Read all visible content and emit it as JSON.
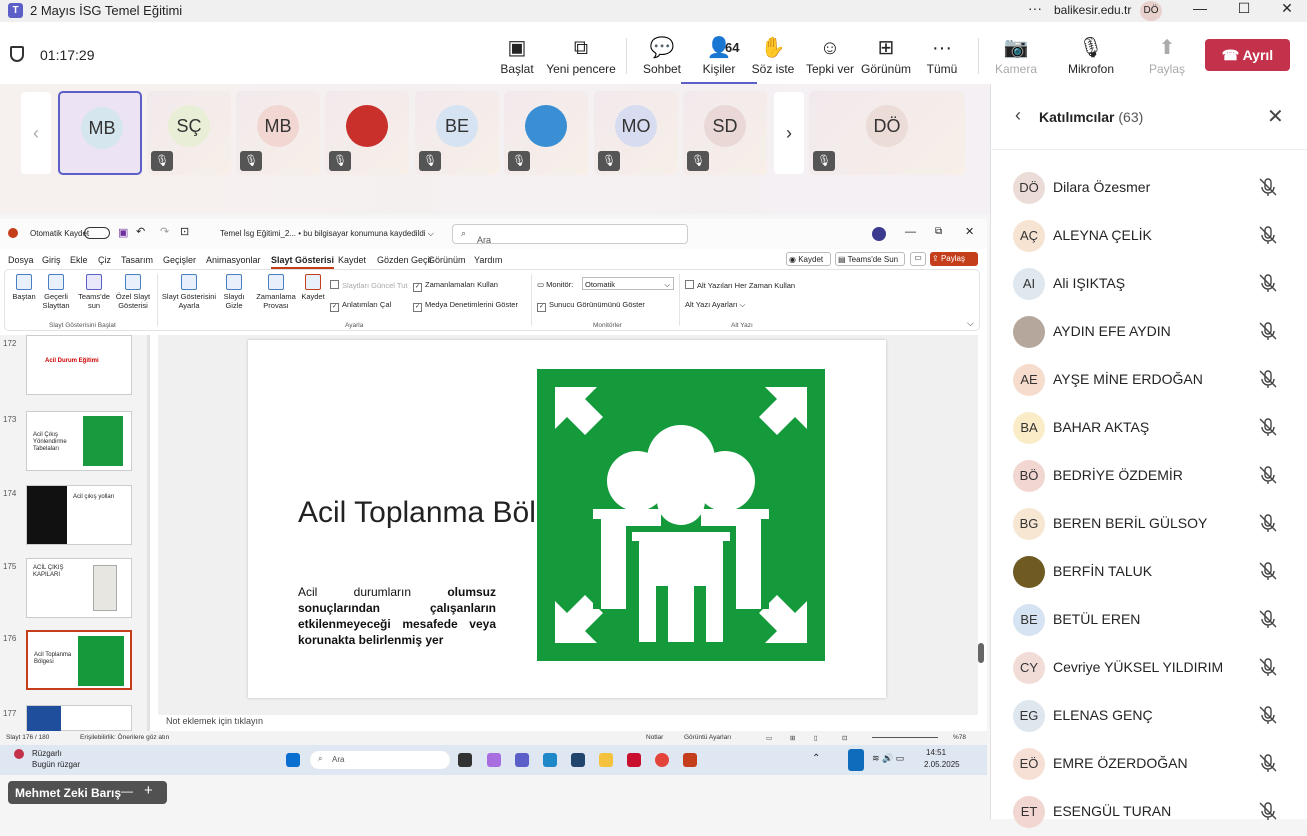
{
  "window": {
    "title": "2 Mayıs İSG Temel Eğitimi",
    "more": "···",
    "org": "balikesir.edu.tr",
    "avatar": "DÖ",
    "minimize": "—",
    "maximize": "☐",
    "close": "✕"
  },
  "meeting": {
    "timer": "01:17:29",
    "buttons": [
      {
        "name": "start-share-button",
        "label": "Başlat",
        "glyph": "▣"
      },
      {
        "name": "new-window-button",
        "label": "Yeni pencere",
        "glyph": "⧉"
      },
      {
        "name": "chat-button",
        "label": "Sohbet",
        "glyph": "💬"
      },
      {
        "name": "people-button",
        "label": "Kişiler",
        "glyph": "👤",
        "badge": "64"
      },
      {
        "name": "raise-hand-button",
        "label": "Söz iste",
        "glyph": "✋"
      },
      {
        "name": "react-button",
        "label": "Tepki ver",
        "glyph": "☺"
      },
      {
        "name": "view-button",
        "label": "Görünüm",
        "glyph": "⊞"
      },
      {
        "name": "more-button",
        "label": "Tümü",
        "glyph": "···"
      },
      {
        "name": "camera-button",
        "label": "Kamera",
        "glyph": "📷"
      },
      {
        "name": "mic-button",
        "label": "Mikrofon",
        "glyph": "🎙"
      },
      {
        "name": "share-button",
        "label": "Paylaş",
        "glyph": "⬆"
      }
    ],
    "leave_label": "Ayrıl"
  },
  "strip": {
    "tiles": [
      {
        "initials": "MB",
        "color": "#d6e6ee"
      },
      {
        "initials": "SÇ",
        "color": "#e8efd6"
      },
      {
        "initials": "MB",
        "color": "#f2d6d2"
      },
      {
        "initials": "",
        "color": "#c9302c"
      },
      {
        "initials": "BE",
        "color": "#d6e3f2"
      },
      {
        "initials": "",
        "color": "#3a8fd4"
      },
      {
        "initials": "MO",
        "color": "#d8dcf0"
      },
      {
        "initials": "SD",
        "color": "#ead8d6"
      },
      {
        "initials": "DÖ",
        "color": "#ecdcd8"
      }
    ],
    "prev": "‹",
    "next": "›"
  },
  "ppt": {
    "autosave": "Otomatik Kaydet",
    "filename": "Temel İsg Eğitimi_2... • bu bilgisayar konumuna kaydedildi ⌵",
    "search_placeholder": "Ara",
    "menu": [
      "Dosya",
      "Giriş",
      "Ekle",
      "Çiz",
      "Tasarım",
      "Geçişler",
      "Animasyonlar",
      "Slayt Gösterisi",
      "Kaydet",
      "Gözden Geçir",
      "Görünüm",
      "Yardım"
    ],
    "right": {
      "save": "Kaydet",
      "teams": "Teams'de Sun",
      "share": "Paylaş"
    },
    "ribbon": {
      "start": "Baştan",
      "current": "Geçerli Slayttan",
      "teams": "Teams'de sun",
      "custom": "Özel Slayt Gösterisi",
      "setup": "Slayt Gösterisini Ayarla",
      "hide": "Slaydı Gizle",
      "rehearse": "Zamanlama Provası",
      "record": "Kaydet",
      "chk_update": "Slaytları Güncel Tut",
      "chk_narration": "Anlatımları Çal",
      "chk_timings": "Zamanlamaları Kullan",
      "chk_media": "Medya Denetimlerini Göster",
      "monitor_label": "Monitör:",
      "monitor_value": "Otomatik",
      "presenter": "Sunucu Görünümünü Göster",
      "subtitles_always": "Alt Yazıları Her Zaman Kullan",
      "subtitle_settings": "Alt Yazı Ayarları ⌵",
      "grp_start": "Slayt Gösterisini Başlat",
      "grp_setup": "Ayarla",
      "grp_monitors": "Monitörler",
      "grp_captions": "Alt Yazı"
    },
    "thumbs": [
      {
        "num": "172",
        "label": "Acil Durum Eğitimi"
      },
      {
        "num": "173",
        "label": "Acil Çıkış Yönlendirme Tabelaları"
      },
      {
        "num": "174",
        "label": "Acil çıkış yolları"
      },
      {
        "num": "175",
        "label": "ACİL ÇIKIŞ KAPILARI"
      },
      {
        "num": "176",
        "label": "Acil Toplanma Bölgesi"
      },
      {
        "num": "177",
        "label": ""
      }
    ],
    "slide": {
      "title": "Acil Toplanma Bölgesi",
      "body_a": "Acil durumların ",
      "body_b": "olumsuz sonuçlarından çalışanların etkilenmeyeceği mesafede veya korunakta belirlenmiş yer"
    },
    "notes": "Not eklemek için tıklayın",
    "status": {
      "slide": "Slayt 176 / 180",
      "access": "Erişilebilirlik: Önerilere göz atın",
      "notes": "Notlar",
      "display": "Görüntü Ayarları",
      "zoom": "%78"
    },
    "taskbar": {
      "weather": "Rüzgarlı",
      "weather_sub": "Bugün rüzgar",
      "search": "Ara",
      "time": "14:51",
      "date": "2.05.2025"
    }
  },
  "presenter_name": "Mehmet Zeki Barış",
  "panel": {
    "title": "Katılımcılar",
    "count": "(63)",
    "back": "‹",
    "close": "✕",
    "people": [
      {
        "initials": "DÖ",
        "name": "Dilara Özesmer",
        "color": "#ecdcd8"
      },
      {
        "initials": "AÇ",
        "name": "ALEYNA ÇELİK",
        "color": "#f6e3d2"
      },
      {
        "initials": "AI",
        "name": "Ali IŞIKTAŞ",
        "color": "#dfe8ee"
      },
      {
        "initials": "",
        "name": "AYDIN EFE AYDIN",
        "color": "#b5a79b"
      },
      {
        "initials": "AE",
        "name": "AYŞE MİNE ERDOĞAN",
        "color": "#f6dccd"
      },
      {
        "initials": "BA",
        "name": "BAHAR AKTAŞ",
        "color": "#fbecc8"
      },
      {
        "initials": "BÖ",
        "name": "BEDRİYE ÖZDEMİR",
        "color": "#f2d6d2"
      },
      {
        "initials": "BG",
        "name": "BEREN BERİL GÜLSOY",
        "color": "#f6e6d2"
      },
      {
        "initials": "",
        "name": "BERFİN TALUK",
        "color": "#6f5a22"
      },
      {
        "initials": "BE",
        "name": "BETÜL EREN",
        "color": "#d6e3f2"
      },
      {
        "initials": "CY",
        "name": "Cevriye YÜKSEL YILDIRIM",
        "color": "#f2dcd8"
      },
      {
        "initials": "EG",
        "name": "ELENAS GENÇ",
        "color": "#dee6ee"
      },
      {
        "initials": "EÖ",
        "name": "EMRE ÖZERDOĞAN",
        "color": "#f6e0d6"
      },
      {
        "initials": "ET",
        "name": "ESENGÜL TURAN",
        "color": "#f2d6d2"
      }
    ]
  }
}
